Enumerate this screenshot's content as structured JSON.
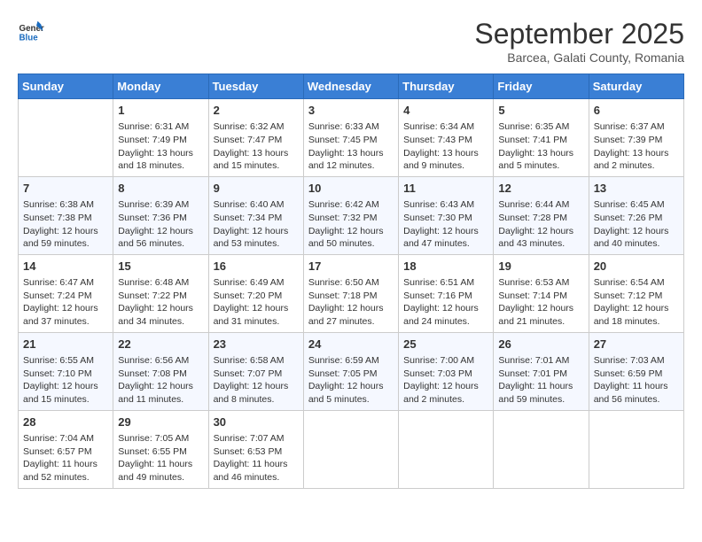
{
  "header": {
    "logo_line1": "General",
    "logo_line2": "Blue",
    "title": "September 2025",
    "subtitle": "Barcea, Galati County, Romania"
  },
  "weekdays": [
    "Sunday",
    "Monday",
    "Tuesday",
    "Wednesday",
    "Thursday",
    "Friday",
    "Saturday"
  ],
  "weeks": [
    [
      {
        "day": "",
        "info": ""
      },
      {
        "day": "1",
        "info": "Sunrise: 6:31 AM\nSunset: 7:49 PM\nDaylight: 13 hours\nand 18 minutes."
      },
      {
        "day": "2",
        "info": "Sunrise: 6:32 AM\nSunset: 7:47 PM\nDaylight: 13 hours\nand 15 minutes."
      },
      {
        "day": "3",
        "info": "Sunrise: 6:33 AM\nSunset: 7:45 PM\nDaylight: 13 hours\nand 12 minutes."
      },
      {
        "day": "4",
        "info": "Sunrise: 6:34 AM\nSunset: 7:43 PM\nDaylight: 13 hours\nand 9 minutes."
      },
      {
        "day": "5",
        "info": "Sunrise: 6:35 AM\nSunset: 7:41 PM\nDaylight: 13 hours\nand 5 minutes."
      },
      {
        "day": "6",
        "info": "Sunrise: 6:37 AM\nSunset: 7:39 PM\nDaylight: 13 hours\nand 2 minutes."
      }
    ],
    [
      {
        "day": "7",
        "info": "Sunrise: 6:38 AM\nSunset: 7:38 PM\nDaylight: 12 hours\nand 59 minutes."
      },
      {
        "day": "8",
        "info": "Sunrise: 6:39 AM\nSunset: 7:36 PM\nDaylight: 12 hours\nand 56 minutes."
      },
      {
        "day": "9",
        "info": "Sunrise: 6:40 AM\nSunset: 7:34 PM\nDaylight: 12 hours\nand 53 minutes."
      },
      {
        "day": "10",
        "info": "Sunrise: 6:42 AM\nSunset: 7:32 PM\nDaylight: 12 hours\nand 50 minutes."
      },
      {
        "day": "11",
        "info": "Sunrise: 6:43 AM\nSunset: 7:30 PM\nDaylight: 12 hours\nand 47 minutes."
      },
      {
        "day": "12",
        "info": "Sunrise: 6:44 AM\nSunset: 7:28 PM\nDaylight: 12 hours\nand 43 minutes."
      },
      {
        "day": "13",
        "info": "Sunrise: 6:45 AM\nSunset: 7:26 PM\nDaylight: 12 hours\nand 40 minutes."
      }
    ],
    [
      {
        "day": "14",
        "info": "Sunrise: 6:47 AM\nSunset: 7:24 PM\nDaylight: 12 hours\nand 37 minutes."
      },
      {
        "day": "15",
        "info": "Sunrise: 6:48 AM\nSunset: 7:22 PM\nDaylight: 12 hours\nand 34 minutes."
      },
      {
        "day": "16",
        "info": "Sunrise: 6:49 AM\nSunset: 7:20 PM\nDaylight: 12 hours\nand 31 minutes."
      },
      {
        "day": "17",
        "info": "Sunrise: 6:50 AM\nSunset: 7:18 PM\nDaylight: 12 hours\nand 27 minutes."
      },
      {
        "day": "18",
        "info": "Sunrise: 6:51 AM\nSunset: 7:16 PM\nDaylight: 12 hours\nand 24 minutes."
      },
      {
        "day": "19",
        "info": "Sunrise: 6:53 AM\nSunset: 7:14 PM\nDaylight: 12 hours\nand 21 minutes."
      },
      {
        "day": "20",
        "info": "Sunrise: 6:54 AM\nSunset: 7:12 PM\nDaylight: 12 hours\nand 18 minutes."
      }
    ],
    [
      {
        "day": "21",
        "info": "Sunrise: 6:55 AM\nSunset: 7:10 PM\nDaylight: 12 hours\nand 15 minutes."
      },
      {
        "day": "22",
        "info": "Sunrise: 6:56 AM\nSunset: 7:08 PM\nDaylight: 12 hours\nand 11 minutes."
      },
      {
        "day": "23",
        "info": "Sunrise: 6:58 AM\nSunset: 7:07 PM\nDaylight: 12 hours\nand 8 minutes."
      },
      {
        "day": "24",
        "info": "Sunrise: 6:59 AM\nSunset: 7:05 PM\nDaylight: 12 hours\nand 5 minutes."
      },
      {
        "day": "25",
        "info": "Sunrise: 7:00 AM\nSunset: 7:03 PM\nDaylight: 12 hours\nand 2 minutes."
      },
      {
        "day": "26",
        "info": "Sunrise: 7:01 AM\nSunset: 7:01 PM\nDaylight: 11 hours\nand 59 minutes."
      },
      {
        "day": "27",
        "info": "Sunrise: 7:03 AM\nSunset: 6:59 PM\nDaylight: 11 hours\nand 56 minutes."
      }
    ],
    [
      {
        "day": "28",
        "info": "Sunrise: 7:04 AM\nSunset: 6:57 PM\nDaylight: 11 hours\nand 52 minutes."
      },
      {
        "day": "29",
        "info": "Sunrise: 7:05 AM\nSunset: 6:55 PM\nDaylight: 11 hours\nand 49 minutes."
      },
      {
        "day": "30",
        "info": "Sunrise: 7:07 AM\nSunset: 6:53 PM\nDaylight: 11 hours\nand 46 minutes."
      },
      {
        "day": "",
        "info": ""
      },
      {
        "day": "",
        "info": ""
      },
      {
        "day": "",
        "info": ""
      },
      {
        "day": "",
        "info": ""
      }
    ]
  ]
}
